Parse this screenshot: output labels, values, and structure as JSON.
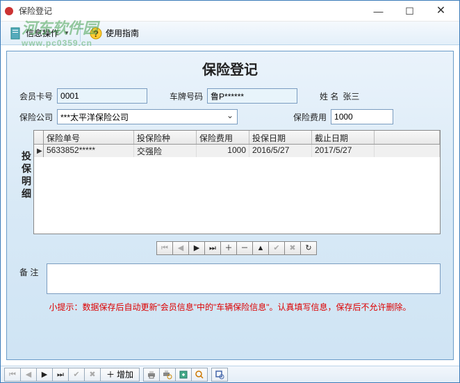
{
  "window": {
    "title": "保险登记"
  },
  "toolbar": {
    "info_ops": "信息操作",
    "guide": "使用指南"
  },
  "watermark": {
    "main": "河东软件园",
    "sub": "www.pc0359.cn"
  },
  "panel": {
    "title": "保险登记",
    "labels": {
      "member_no": "会员卡号",
      "plate_no": "车牌号码",
      "name": "姓    名",
      "company": "保险公司",
      "fee": "保险费用",
      "detail": "投保明细",
      "remark": "备    注"
    },
    "fields": {
      "member_no": "0001",
      "plate_no": "鲁P******",
      "name": "张三",
      "company": "***太平洋保险公司",
      "fee": "1000",
      "remark": ""
    }
  },
  "grid": {
    "headers": {
      "c1": "保险单号",
      "c2": "投保险种",
      "c3": "保险费用",
      "c4": "投保日期",
      "c5": "截止日期"
    },
    "rows": [
      {
        "c1": "5633852*****",
        "c2": "交强险",
        "c3": "1000",
        "c4": "2016/5/27",
        "c5": "2017/5/27"
      }
    ]
  },
  "nav_icons": {
    "first": "⏮",
    "prev": "◀",
    "next": "▶",
    "last": "⏭",
    "add": "＋",
    "del": "－",
    "edit": "▲",
    "ok": "✔",
    "cancel": "✖",
    "refresh": "↻"
  },
  "tip": "小提示：数据保存后自动更新\"会员信息\"中的\"车辆保险信息\"。认真填写信息，保存后不允许删除。",
  "bottombar": {
    "add_label": "增加"
  }
}
